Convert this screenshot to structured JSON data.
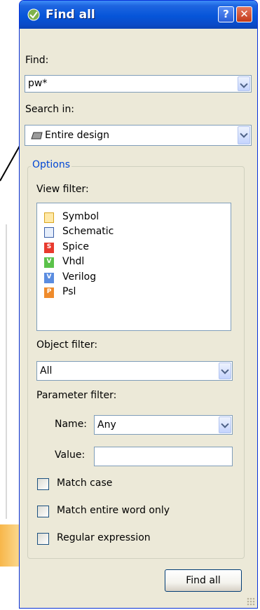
{
  "window": {
    "title": "Find all",
    "help_label": "?",
    "close_label": "✕"
  },
  "find": {
    "label": "Find:",
    "value": "pw*"
  },
  "search_in": {
    "label": "Search in:",
    "value": "Entire design"
  },
  "options": {
    "legend": "Options",
    "view_filter_label": "View filter:",
    "view_items": [
      {
        "label": "Symbol",
        "icon": "symbol-icon"
      },
      {
        "label": "Schematic",
        "icon": "schematic-icon"
      },
      {
        "label": "Spice",
        "icon": "spice-icon",
        "glyph": "S"
      },
      {
        "label": "Vhdl",
        "icon": "vhdl-icon",
        "glyph": "V"
      },
      {
        "label": "Verilog",
        "icon": "verilog-icon",
        "glyph": "V"
      },
      {
        "label": "Psl",
        "icon": "psl-icon",
        "glyph": "P"
      }
    ],
    "object_filter_label": "Object filter:",
    "object_filter_value": "All",
    "parameter_filter_label": "Parameter filter:",
    "name_label": "Name:",
    "name_value": "Any",
    "value_label": "Value:",
    "value_value": "",
    "checkboxes": [
      {
        "label": "Match case",
        "checked": false
      },
      {
        "label": "Match entire word only",
        "checked": false
      },
      {
        "label": "Regular expression",
        "checked": false
      }
    ]
  },
  "find_all_button": "Find all"
}
